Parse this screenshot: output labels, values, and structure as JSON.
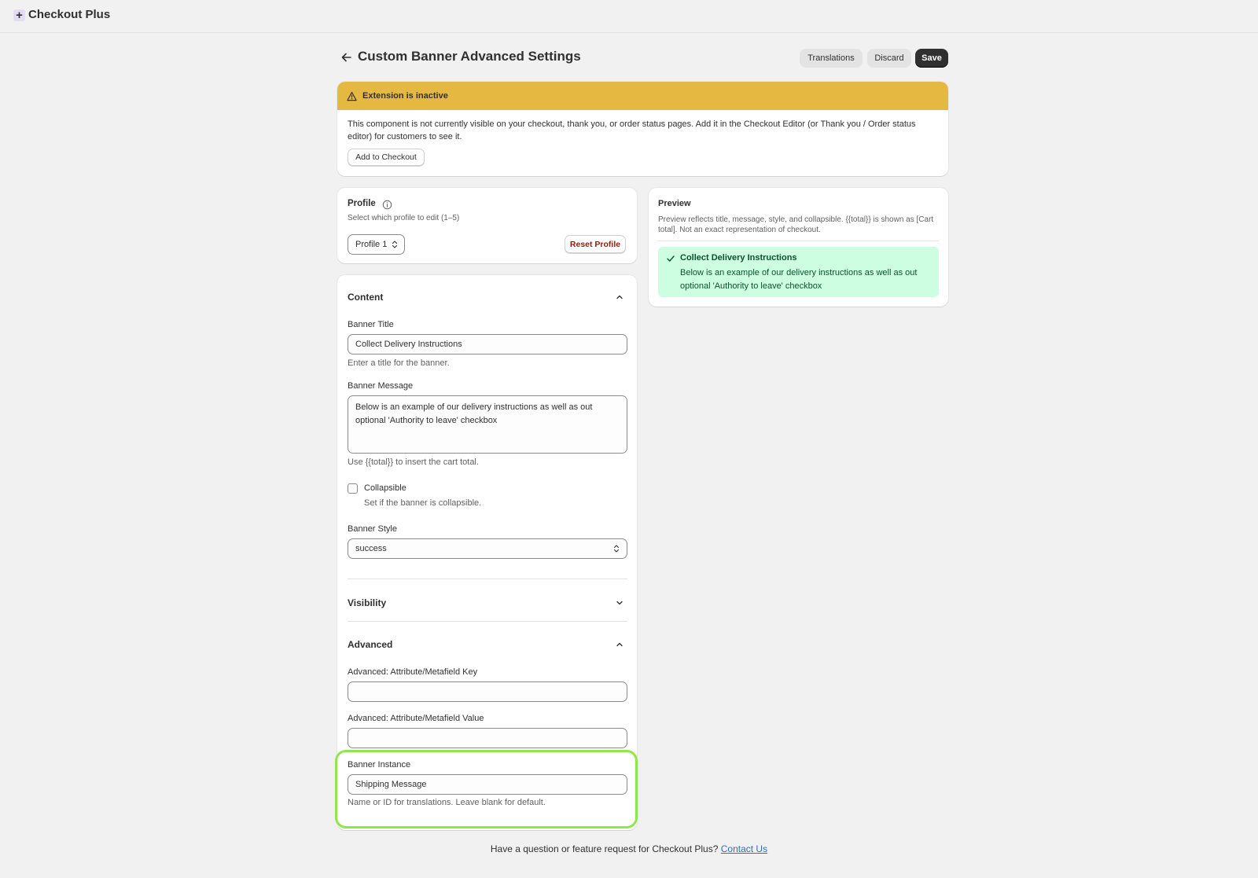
{
  "app": {
    "name": "Checkout Plus",
    "logo_glyph": "+"
  },
  "header": {
    "title": "Custom Banner Advanced Settings",
    "translations_label": "Translations",
    "discard_label": "Discard",
    "save_label": "Save"
  },
  "warning": {
    "title": "Extension is inactive",
    "body": "This component is not currently visible on your checkout, thank you, or order status pages. Add it in the Checkout Editor (or Thank you / Order status editor) for customers to see it.",
    "button_label": "Add to Checkout",
    "color": "#e5b941"
  },
  "profile": {
    "title": "Profile",
    "subtitle": "Select which profile to edit (1–5)",
    "selected": "Profile 1",
    "reset_label": "Reset Profile"
  },
  "preview": {
    "title": "Preview",
    "description": "Preview reflects title, message, style, and collapsible. {{total}} is shown as [Cart total]. Not an exact representation of checkout.",
    "banner_title": "Collect Delivery Instructions",
    "banner_message": "Below is an example of our delivery instructions as well as out optional 'Authority to leave' checkbox",
    "banner_color": "#cdfee1"
  },
  "content": {
    "section_title": "Content",
    "banner_title_label": "Banner Title",
    "banner_title_value": "Collect Delivery Instructions",
    "banner_title_help": "Enter a title for the banner.",
    "banner_message_label": "Banner Message",
    "banner_message_value": "Below is an example of our delivery instructions as well as out optional 'Authority to leave' checkbox",
    "banner_message_help": "Use {{total}} to insert the cart total.",
    "collapsible_label": "Collapsible",
    "collapsible_help": "Set if the banner is collapsible.",
    "collapsible_checked": false,
    "banner_style_label": "Banner Style",
    "banner_style_value": "success"
  },
  "visibility": {
    "section_title": "Visibility"
  },
  "advanced": {
    "section_title": "Advanced",
    "key_label": "Advanced: Attribute/Metafield Key",
    "key_value": "",
    "value_label": "Advanced: Attribute/Metafield Value",
    "value_value": "",
    "instance_label": "Banner Instance",
    "instance_value": "Shipping Message",
    "instance_help": "Name or ID for translations. Leave blank for default."
  },
  "footer": {
    "text": "Have a question or feature request for Checkout Plus?",
    "link": "Contact Us"
  },
  "icons": [
    "plus-logo-icon",
    "back-arrow-icon",
    "warning-icon",
    "info-icon",
    "updown-icon",
    "check-icon",
    "chevron-up-icon",
    "chevron-down-icon"
  ],
  "highlight_color": "#8fe84a"
}
